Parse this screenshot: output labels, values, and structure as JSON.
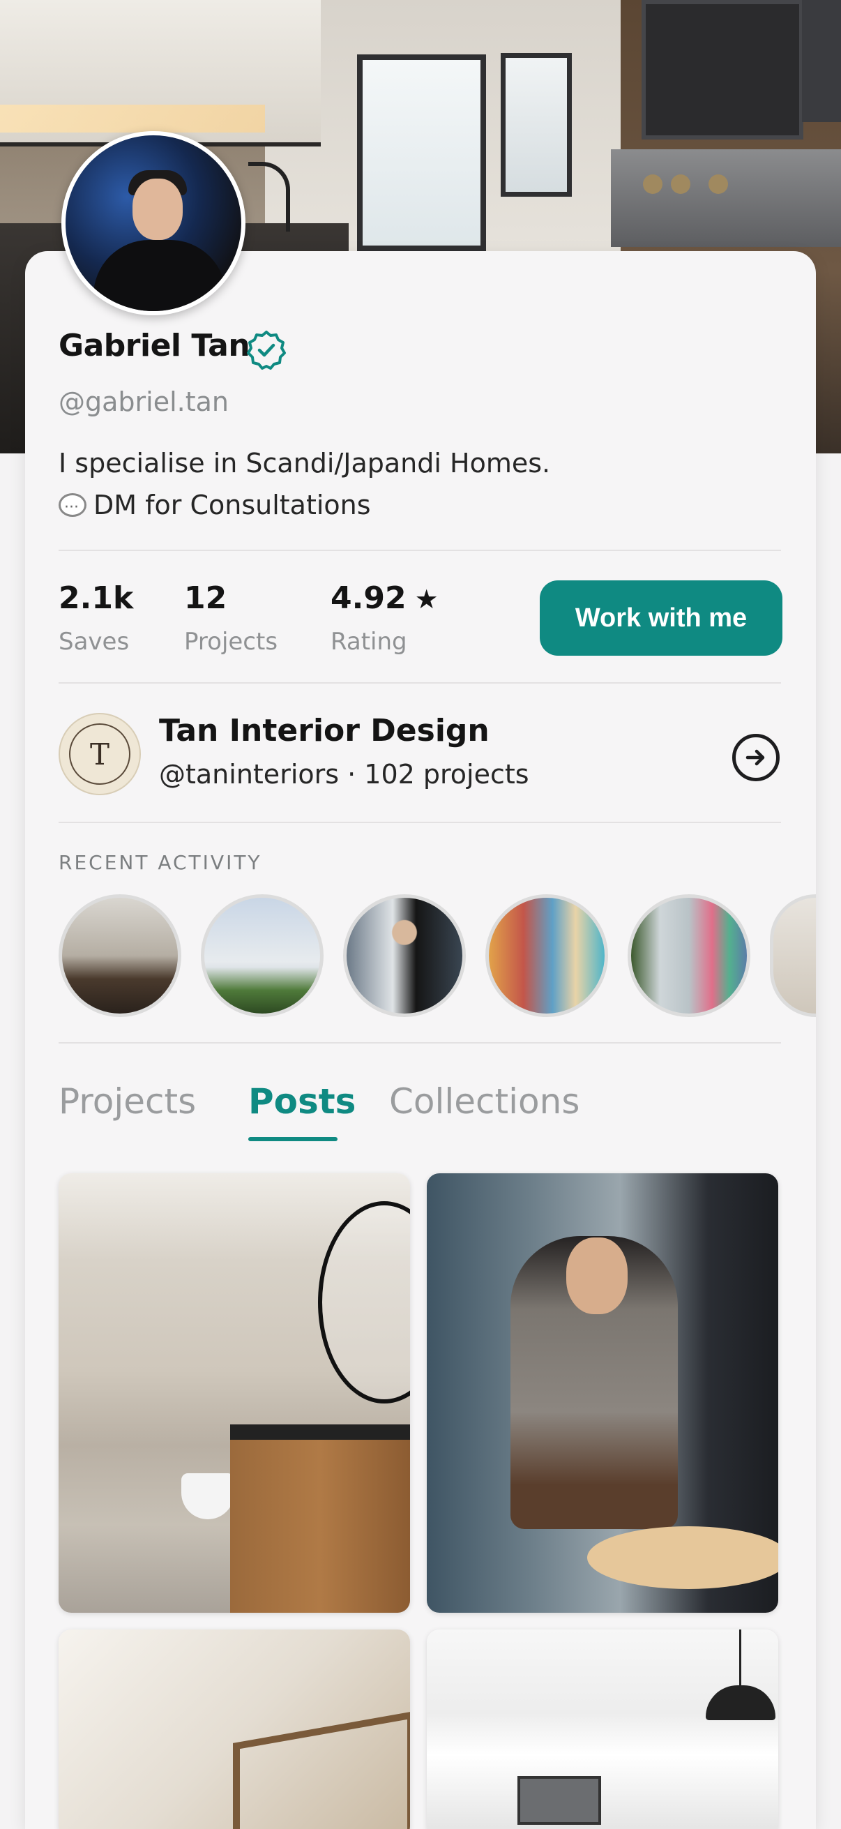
{
  "profile": {
    "name": "Gabriel Tan",
    "handle": "@gabriel.tan",
    "bio_line1": "I specialise in Scandi/Japandi Homes.",
    "bio_line2": "DM for Consultations",
    "verified_icon": "verified-badge-icon"
  },
  "stats": {
    "saves_value": "2.1k",
    "saves_label": "Saves",
    "projects_value": "12",
    "projects_label": "Projects",
    "rating_value": "4.92",
    "rating_star": "★",
    "rating_label": "Rating"
  },
  "cta": {
    "work_label": "Work with me"
  },
  "firm": {
    "logo_letter": "T",
    "name": "Tan Interior Design",
    "subtitle": "@taninteriors · 102 projects"
  },
  "activity": {
    "title": "RECENT ACTIVITY"
  },
  "tabs": [
    {
      "label": "Projects"
    },
    {
      "label": "Posts"
    },
    {
      "label": "Collections"
    }
  ],
  "colors": {
    "accent": "#0f8a82",
    "text": "#141414",
    "muted": "#8a8d8f"
  }
}
